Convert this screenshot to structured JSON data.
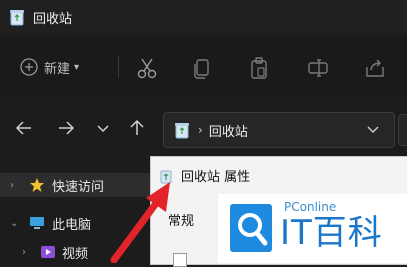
{
  "window": {
    "title": "回收站",
    "icon": "recycle-bin-icon"
  },
  "toolbar": {
    "new_label": "新建",
    "new_icon": "plus-circle-icon",
    "tools": [
      "cut-icon",
      "copy-icon",
      "paste-icon",
      "rename-icon",
      "share-icon"
    ]
  },
  "nav": {
    "address_path": "回收站",
    "buttons": [
      "back-arrow-icon",
      "forward-arrow-icon",
      "recent-chevron-icon",
      "up-arrow-icon"
    ]
  },
  "sidebar": {
    "items": [
      {
        "label": "快速访问",
        "icon": "star-icon"
      },
      {
        "label": "此电脑",
        "icon": "monitor-icon"
      },
      {
        "label": "视频",
        "icon": "video-icon"
      }
    ]
  },
  "dialog": {
    "title": "回收站 属性",
    "tab_label": "常规"
  },
  "watermark": {
    "small": "PConline",
    "big": "IT百科"
  },
  "colors": {
    "accent": "#1a77c9",
    "annotation_arrow": "#e2242a"
  }
}
